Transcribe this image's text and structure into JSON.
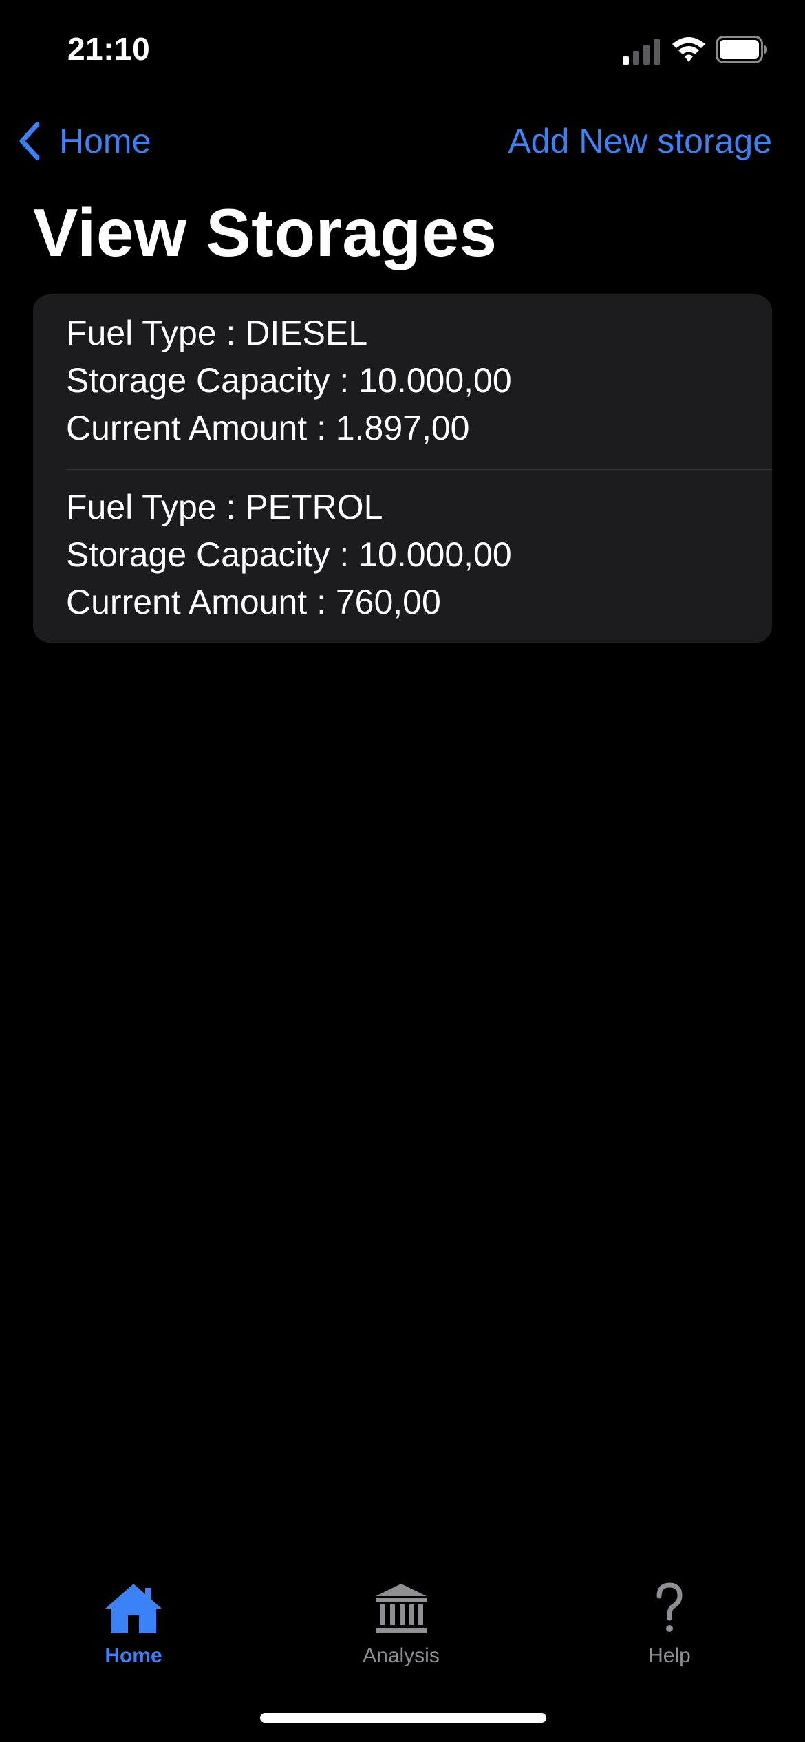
{
  "status_bar": {
    "time": "21:10"
  },
  "nav": {
    "back_label": "Home",
    "action_label": "Add New storage"
  },
  "page": {
    "title": "View Storages"
  },
  "storages": [
    {
      "fuel_type": "Fuel Type : DIESEL",
      "capacity": "Storage Capacity : 10.000,00",
      "current_amount": "Current Amount : 1.897,00"
    },
    {
      "fuel_type": "Fuel Type : PETROL",
      "capacity": "Storage Capacity : 10.000,00",
      "current_amount": "Current Amount : 760,00"
    }
  ],
  "tab_bar": {
    "tabs": [
      {
        "label": "Home",
        "icon": "house-icon",
        "active": true
      },
      {
        "label": "Analysis",
        "icon": "bank-icon",
        "active": false
      },
      {
        "label": "Help",
        "icon": "question-icon",
        "active": false
      }
    ]
  },
  "colors": {
    "accent": "#3b82f6",
    "background": "#000000",
    "card": "#1c1c1e",
    "inactive": "#8e8e93"
  }
}
